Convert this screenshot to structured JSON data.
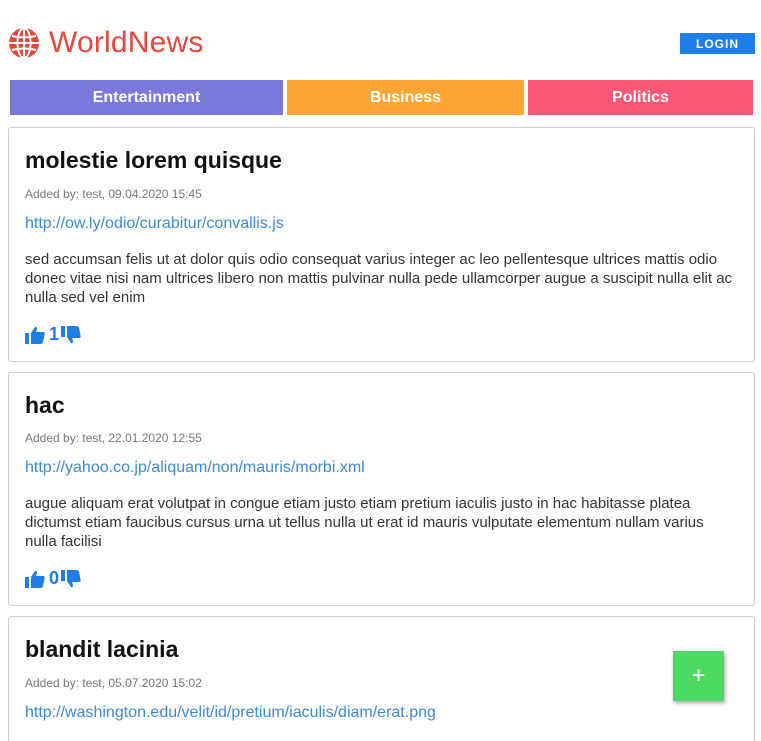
{
  "brand": {
    "title": "WorldNews",
    "icon": "globe-icon",
    "color": "#e8463b"
  },
  "header": {
    "login_label": "LOGIN"
  },
  "categories": [
    {
      "label": "Entertainment",
      "color": "#7b78dc"
    },
    {
      "label": "Business",
      "color": "#fba634"
    },
    {
      "label": "Politics",
      "color": "#fa5778"
    }
  ],
  "posts": [
    {
      "title": "molestie lorem quisque",
      "meta": "Added by: test, 09.04.2020 15:45",
      "link": "http://ow.ly/odio/curabitur/convallis.js",
      "body": "sed accumsan felis ut at dolor quis odio consequat varius integer ac leo pellentesque ultrices mattis odio donec vitae nisi nam ultrices libero non mattis pulvinar nulla pede ullamcorper augue a suscipit nulla elit ac nulla sed vel enim",
      "votes": "1"
    },
    {
      "title": "hac",
      "meta": "Added by: test, 22.01.2020 12:55",
      "link": "http://yahoo.co.jp/aliquam/non/mauris/morbi.xml",
      "body": "augue aliquam erat volutpat in congue etiam justo etiam pretium iaculis justo in hac habitasse platea dictumst etiam faucibus cursus urna ut tellus nulla ut erat id mauris vulputate elementum nullam varius nulla facilisi",
      "votes": "0"
    },
    {
      "title": "blandit lacinia",
      "meta": "Added by: test, 05.07.2020 15:02",
      "link": "http://washington.edu/velit/id/pretium/iaculis/diam/erat.png"
    }
  ],
  "fab": {
    "label": "+",
    "color": "#4cd964"
  },
  "accent_color": "#1f7de8"
}
